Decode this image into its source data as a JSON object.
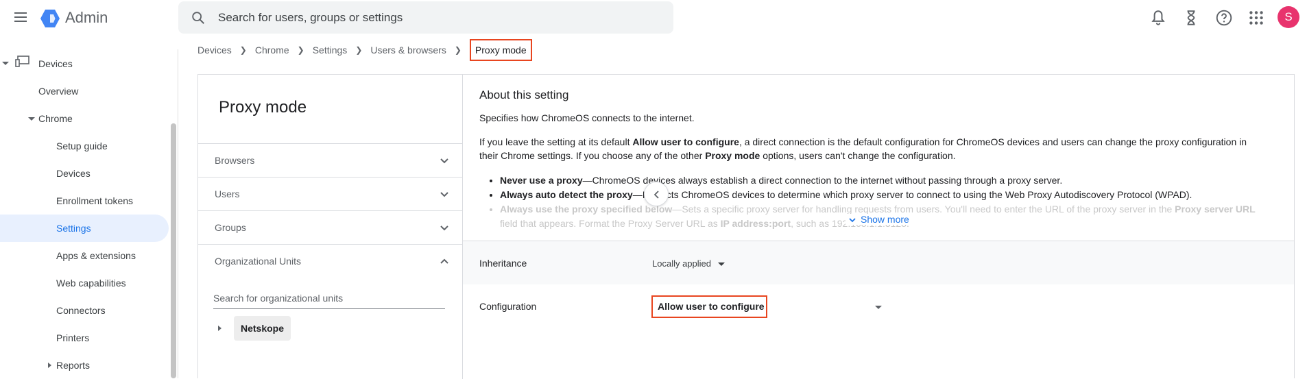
{
  "app": {
    "title": "Admin",
    "brand_color": "#1a73e8",
    "avatar_letter": "S",
    "avatar_color": "#e8336d"
  },
  "search": {
    "placeholder": "Search for users, groups or settings"
  },
  "top_icons": [
    "bell-icon",
    "hourglass-icon",
    "help-icon",
    "apps-grid-icon"
  ],
  "sidebar": {
    "items": [
      {
        "label": "Devices"
      },
      {
        "label": "Overview"
      },
      {
        "label": "Chrome"
      },
      {
        "label": "Setup guide"
      },
      {
        "label": "Devices"
      },
      {
        "label": "Enrollment tokens"
      },
      {
        "label": "Settings",
        "active": true
      },
      {
        "label": "Apps & extensions"
      },
      {
        "label": "Web capabilities"
      },
      {
        "label": "Connectors"
      },
      {
        "label": "Printers"
      },
      {
        "label": "Reports"
      }
    ]
  },
  "breadcrumb": {
    "items": [
      "Devices",
      "Chrome",
      "Settings",
      "Users & browsers"
    ],
    "current": "Proxy mode"
  },
  "left_panel": {
    "title": "Proxy mode",
    "filters": [
      {
        "label": "Browsers",
        "expanded": false
      },
      {
        "label": "Users",
        "expanded": false
      },
      {
        "label": "Groups",
        "expanded": false
      },
      {
        "label": "Organizational Units",
        "expanded": true
      }
    ],
    "ou_search_placeholder": "Search for organizational units",
    "ou_root": "Netskope"
  },
  "about": {
    "title": "About this setting",
    "p1": "Specifies how ChromeOS connects to the internet.",
    "p2_a": "If you leave the setting at its default ",
    "p2_b": "Allow user to configure",
    "p2_c": ", a direct connection is the default configuration for ChromeOS devices and users can change the proxy configuration in their Chrome settings. If you choose any of the other ",
    "p2_d": "Proxy mode",
    "p2_e": " options, users can't change the configuration.",
    "bullets": [
      {
        "bold": "Never use a proxy",
        "text": "—ChromeOS devices always establish a direct connection to the internet without passing through a proxy server."
      },
      {
        "bold": "Always auto detect the proxy",
        "text": "—Instructs ChromeOS devices to determine which proxy server to connect to using the Web Proxy Autodiscovery Protocol (WPAD)."
      },
      {
        "bold": "Always use the proxy specified below",
        "text": "—Sets a specific proxy server for handling requests from users. You'll need to enter the URL of the proxy server in the ",
        "bold2": "Proxy server URL",
        "text2": " field that appears. Format the Proxy Server URL as ",
        "bold3": "IP address:port",
        "text3": ", such as 192.168.1.1:3128."
      }
    ],
    "show_more": "Show more"
  },
  "inheritance": {
    "label": "Inheritance",
    "value": "Locally applied"
  },
  "configuration": {
    "label": "Configuration",
    "value": "Allow user to configure"
  },
  "highlight_color": "#e8451f"
}
